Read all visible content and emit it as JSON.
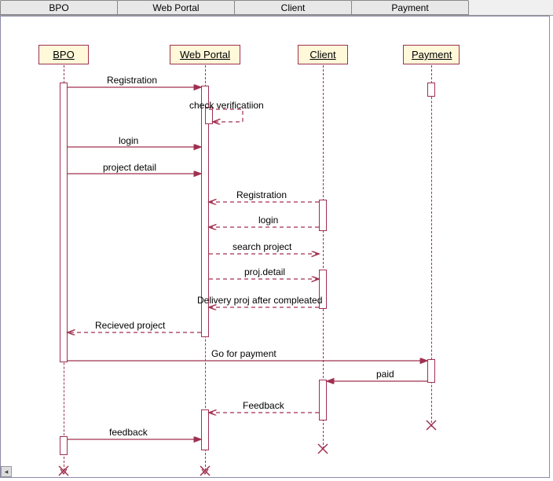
{
  "tabs": [
    "BPO",
    "Web Portal",
    "Client",
    "Payment"
  ],
  "lifelines": {
    "bpo": "BPO",
    "web": "Web Portal",
    "client": "Client",
    "payment": "Payment"
  },
  "messages": {
    "m1": "Registration",
    "m2": "check verificatiion",
    "m3": "login",
    "m4": "project detail",
    "m5": "Registration",
    "m6": "login",
    "m7": "search project",
    "m8": "proj.detail",
    "m9": "Delivery proj after compleated",
    "m10": "Recieved project",
    "m11": "Go for payment",
    "m12": "paid",
    "m13": "Feedback",
    "m14": "feedback"
  },
  "chart_data": {
    "type": "sequence-diagram",
    "title": "",
    "lifelines": [
      "BPO",
      "Web Portal",
      "Client",
      "Payment"
    ],
    "messages": [
      {
        "from": "BPO",
        "to": "Web Portal",
        "label": "Registration",
        "style": "solid"
      },
      {
        "from": "Web Portal",
        "to": "Web Portal",
        "label": "check verificatiion",
        "style": "dashed"
      },
      {
        "from": "BPO",
        "to": "Web Portal",
        "label": "login",
        "style": "solid"
      },
      {
        "from": "BPO",
        "to": "Web Portal",
        "label": "project detail",
        "style": "solid"
      },
      {
        "from": "Client",
        "to": "Web Portal",
        "label": "Registration",
        "style": "dashed"
      },
      {
        "from": "Client",
        "to": "Web Portal",
        "label": "login",
        "style": "dashed"
      },
      {
        "from": "Web Portal",
        "to": "Client",
        "label": "search project",
        "style": "dashed"
      },
      {
        "from": "Web Portal",
        "to": "Client",
        "label": "proj.detail",
        "style": "dashed"
      },
      {
        "from": "Client",
        "to": "Web Portal",
        "label": "Delivery proj after compleated",
        "style": "dashed"
      },
      {
        "from": "Web Portal",
        "to": "BPO",
        "label": "Recieved project",
        "style": "dashed"
      },
      {
        "from": "BPO",
        "to": "Payment",
        "label": "Go for payment",
        "style": "solid"
      },
      {
        "from": "Payment",
        "to": "Client",
        "label": "paid",
        "style": "solid"
      },
      {
        "from": "Client",
        "to": "Web Portal",
        "label": "Feedback",
        "style": "dashed"
      },
      {
        "from": "BPO",
        "to": "Web Portal",
        "label": "feedback",
        "style": "solid"
      }
    ]
  }
}
